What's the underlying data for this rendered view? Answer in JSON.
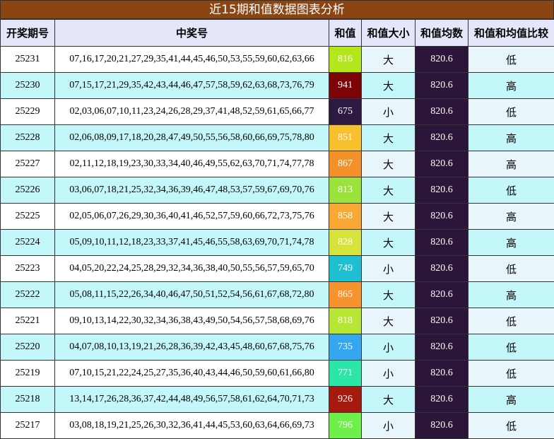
{
  "title": "近15期和值数据图表分析",
  "headers": [
    "开奖期号",
    "中奖号",
    "和值",
    "和值大小",
    "和值均数",
    "和值和均值比较"
  ],
  "rows": [
    {
      "issue": "25231",
      "numbers": "07,16,17,20,21,27,29,35,41,44,45,46,50,53,55,59,60,62,63,66",
      "sum": "816",
      "sum_color": "#b4e61c",
      "size": "大",
      "avg": "820.6",
      "cmp": "低"
    },
    {
      "issue": "25230",
      "numbers": "07,15,17,21,29,35,42,43,44,46,47,57,58,59,62,63,68,73,76,79",
      "sum": "941",
      "sum_color": "#7a0406",
      "size": "大",
      "avg": "820.6",
      "cmp": "高"
    },
    {
      "issue": "25229",
      "numbers": "02,03,06,07,10,11,23,24,26,28,29,37,41,48,52,59,61,65,66,77",
      "sum": "675",
      "sum_color": "#2d1a42",
      "size": "小",
      "avg": "820.6",
      "cmp": "低"
    },
    {
      "issue": "25228",
      "numbers": "02,06,08,09,17,18,20,28,47,49,50,55,56,58,60,66,69,75,78,80",
      "sum": "851",
      "sum_color": "#f7c02c",
      "size": "大",
      "avg": "820.6",
      "cmp": "高"
    },
    {
      "issue": "25227",
      "numbers": "02,11,12,18,19,23,30,33,34,40,46,49,55,62,63,70,71,74,77,78",
      "sum": "867",
      "sum_color": "#f5912b",
      "size": "大",
      "avg": "820.6",
      "cmp": "高"
    },
    {
      "issue": "25226",
      "numbers": "03,06,07,18,21,25,32,34,36,39,46,47,48,53,57,59,67,69,70,76",
      "sum": "813",
      "sum_color": "#9be23a",
      "size": "大",
      "avg": "820.6",
      "cmp": "低"
    },
    {
      "issue": "25225",
      "numbers": "02,05,06,07,26,29,30,36,40,41,46,52,57,59,60,66,72,73,75,76",
      "sum": "858",
      "sum_color": "#f9a933",
      "size": "大",
      "avg": "820.6",
      "cmp": "高"
    },
    {
      "issue": "25224",
      "numbers": "05,09,10,11,12,18,23,33,37,41,45,46,55,58,63,69,70,71,74,78",
      "sum": "828",
      "sum_color": "#d6e33a",
      "size": "大",
      "avg": "820.6",
      "cmp": "高"
    },
    {
      "issue": "25223",
      "numbers": "04,05,20,22,24,25,28,29,32,34,36,38,40,50,55,56,57,59,65,70",
      "sum": "749",
      "sum_color": "#1ebfd0",
      "size": "小",
      "avg": "820.6",
      "cmp": "低"
    },
    {
      "issue": "25222",
      "numbers": "05,08,11,15,22,26,34,40,46,47,50,51,52,54,56,61,67,68,72,80",
      "sum": "865",
      "sum_color": "#f7932d",
      "size": "大",
      "avg": "820.6",
      "cmp": "高"
    },
    {
      "issue": "25221",
      "numbers": "09,10,13,14,22,30,32,34,36,38,43,49,50,54,56,57,58,68,69,76",
      "sum": "818",
      "sum_color": "#b8e634",
      "size": "大",
      "avg": "820.6",
      "cmp": "低"
    },
    {
      "issue": "25220",
      "numbers": "04,07,08,10,13,19,21,26,28,36,39,42,43,45,48,60,67,68,75,76",
      "sum": "735",
      "sum_color": "#35a6f0",
      "size": "小",
      "avg": "820.6",
      "cmp": "低"
    },
    {
      "issue": "25219",
      "numbers": "07,10,15,21,22,24,25,27,35,36,40,43,44,46,50,59,60,61,66,80",
      "sum": "771",
      "sum_color": "#2ce6a8",
      "size": "小",
      "avg": "820.6",
      "cmp": "低"
    },
    {
      "issue": "25218",
      "numbers": "13,14,17,26,28,36,37,42,44,48,49,56,57,58,61,62,64,70,71,73",
      "sum": "926",
      "sum_color": "#a41b0e",
      "size": "大",
      "avg": "820.6",
      "cmp": "高"
    },
    {
      "issue": "25217",
      "numbers": "03,08,18,19,21,25,26,30,32,36,41,44,45,53,60,63,64,66,69,73",
      "sum": "796",
      "sum_color": "#6ef04a",
      "size": "小",
      "avg": "820.6",
      "cmp": "低"
    }
  ]
}
